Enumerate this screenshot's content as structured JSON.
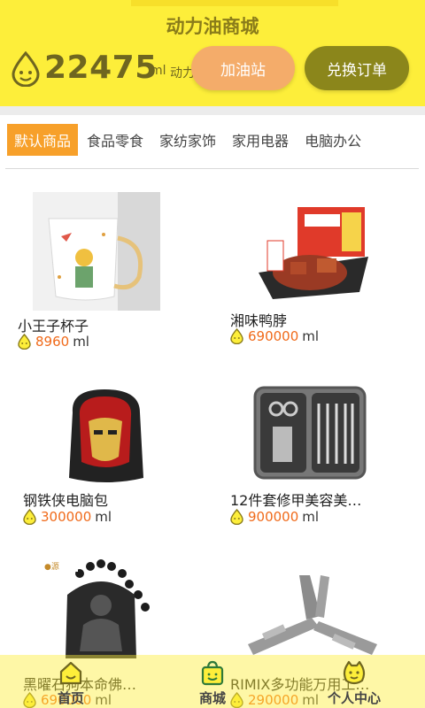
{
  "header": {
    "title": "动力油商城",
    "points": "22475",
    "unit": "ml",
    "unit_suffix": "动力",
    "fuel_button": "加油站",
    "order_button": "兑换订单"
  },
  "tabs": [
    {
      "label": "默认商品",
      "active": true
    },
    {
      "label": "食品零食",
      "active": false
    },
    {
      "label": "家纺家饰",
      "active": false
    },
    {
      "label": "家用电器",
      "active": false
    },
    {
      "label": "电脑办公",
      "active": false
    }
  ],
  "products": [
    {
      "name": "小王子杯子",
      "price": "8960",
      "unit": "ml"
    },
    {
      "name": "湘味鸭脖",
      "price": "690000",
      "unit": "ml"
    },
    {
      "name": "钢铁侠电脑包",
      "price": "300000",
      "unit": "ml"
    },
    {
      "name": "12件套修甲美容美…",
      "price": "900000",
      "unit": "ml"
    },
    {
      "name": "黑曜石狗本命佛…",
      "price": "690000",
      "unit": "ml"
    },
    {
      "name": "RIMIX多功能万用工…",
      "price": "290000",
      "unit": "ml"
    }
  ],
  "nav": {
    "home": "首页",
    "mall": "商城",
    "profile": "个人中心"
  },
  "colors": {
    "header_bg": "#fdee3a",
    "tab_active": "#f7a02a",
    "price": "#f06a1a",
    "fuel_button": "#f4ac6a",
    "order_button": "#8b861b"
  }
}
